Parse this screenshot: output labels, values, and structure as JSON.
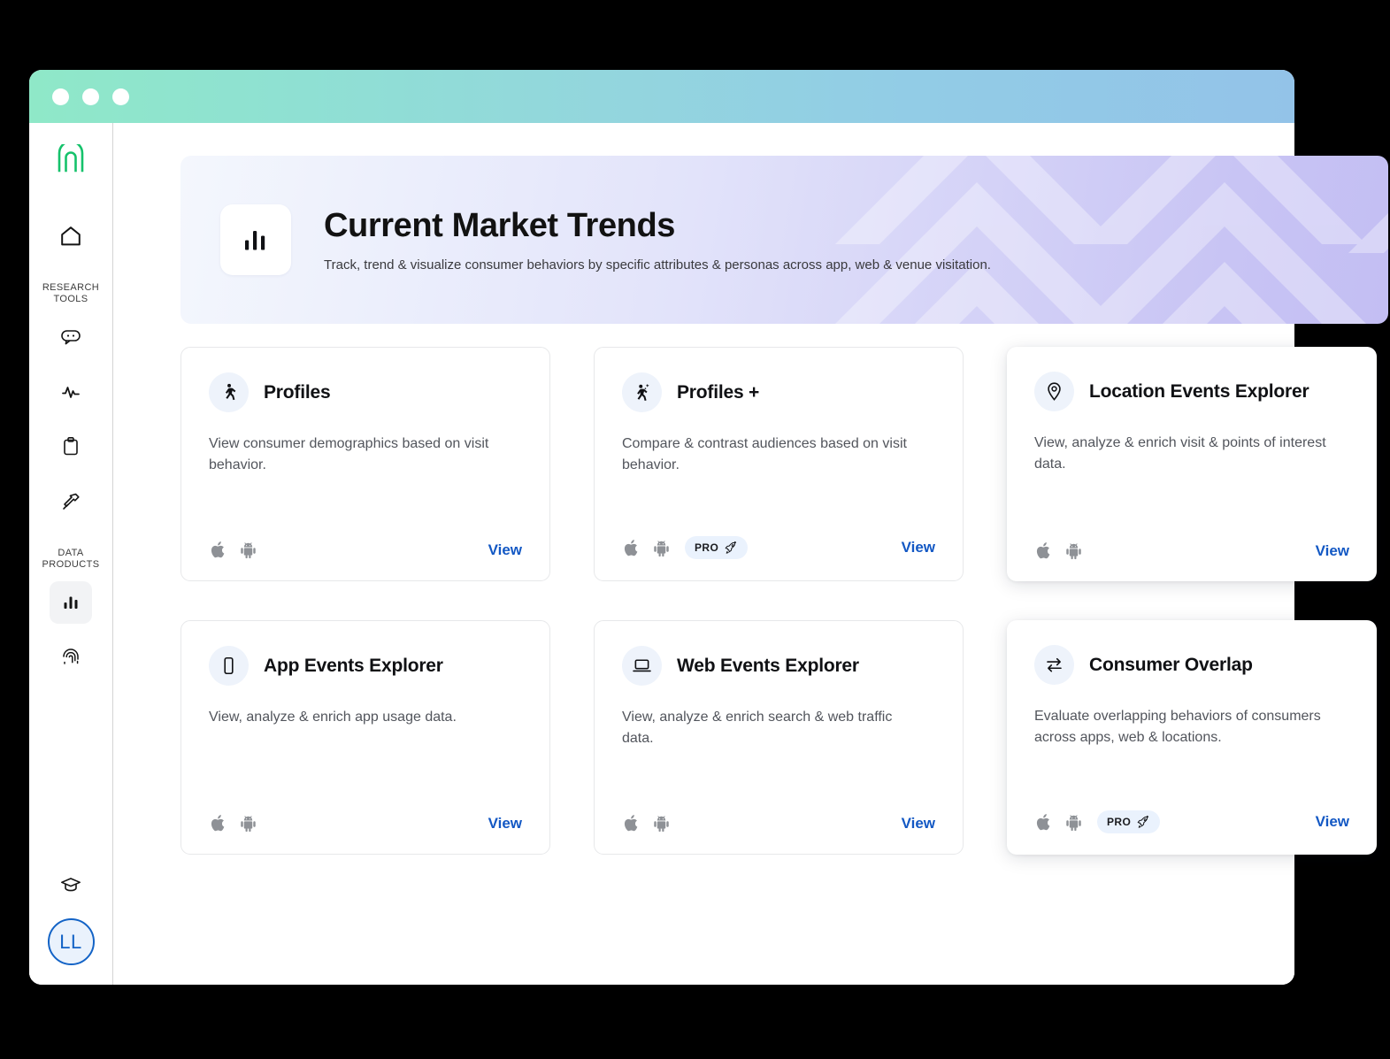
{
  "window": {
    "traffic_lights": [
      "close",
      "minimize",
      "maximize"
    ]
  },
  "sidebar": {
    "logo_name": "app-logo",
    "home_label": "Home",
    "sections": [
      {
        "label": "RESEARCH\nTOOLS",
        "label_line1": "RESEARCH",
        "label_line2": "TOOLS",
        "items": [
          {
            "icon": "chat-bubble-icon",
            "label": "Chat"
          },
          {
            "icon": "activity-pulse-icon",
            "label": "Activity"
          },
          {
            "icon": "clipboard-icon",
            "label": "Clipboard"
          },
          {
            "icon": "hammer-icon",
            "label": "Tools"
          }
        ]
      },
      {
        "label": "DATA\nPRODUCTS",
        "label_line1": "DATA",
        "label_line2": "PRODUCTS",
        "items": [
          {
            "icon": "bar-chart-icon",
            "label": "Data Products",
            "active": true
          },
          {
            "icon": "fingerprint-icon",
            "label": "Identity"
          }
        ]
      }
    ],
    "footer": {
      "help_icon": "graduation-cap-icon",
      "help_label": "Learning",
      "avatar_initials": "LL"
    }
  },
  "hero": {
    "icon": "bar-chart-icon",
    "title": "Current Market Trends",
    "subtitle": "Track, trend & visualize consumer behaviors by specific attributes & personas across app, web & venue visitation.",
    "accent_start": "#f4f7fd",
    "accent_end": "#c3bef3"
  },
  "cards": [
    {
      "id": "profiles",
      "icon": "walking-person-icon",
      "title": "Profiles",
      "description": "View consumer demographics based on visit behavior.",
      "platforms": [
        "apple-icon",
        "android-icon"
      ],
      "pro": false,
      "pro_label": "PRO",
      "action_label": "View",
      "floating": false
    },
    {
      "id": "profiles-plus",
      "icon": "walking-person-sparkle-icon",
      "title": "Profiles +",
      "description": "Compare & contrast audiences based on visit behavior.",
      "platforms": [
        "apple-icon",
        "android-icon"
      ],
      "pro": true,
      "pro_label": "PRO",
      "action_label": "View",
      "floating": false
    },
    {
      "id": "location-events-explorer",
      "icon": "map-pin-icon",
      "title": "Location Events Explorer",
      "description": "View, analyze & enrich visit & points of interest data.",
      "platforms": [
        "apple-icon",
        "android-icon"
      ],
      "pro": false,
      "pro_label": "PRO",
      "action_label": "View",
      "floating": true
    },
    {
      "id": "app-events-explorer",
      "icon": "mobile-phone-icon",
      "title": "App Events Explorer",
      "description": "View, analyze & enrich app usage data.",
      "platforms": [
        "apple-icon",
        "android-icon"
      ],
      "pro": false,
      "pro_label": "PRO",
      "action_label": "View",
      "floating": false
    },
    {
      "id": "web-events-explorer",
      "icon": "laptop-icon",
      "title": "Web Events Explorer",
      "description": "View, analyze & enrich search & web traffic data.",
      "platforms": [
        "apple-icon",
        "android-icon"
      ],
      "pro": false,
      "pro_label": "PRO",
      "action_label": "View",
      "floating": false
    },
    {
      "id": "consumer-overlap",
      "icon": "exchange-arrows-icon",
      "title": "Consumer Overlap",
      "description": "Evaluate overlapping behaviors of consumers across apps, web & locations.",
      "platforms": [
        "apple-icon",
        "android-icon"
      ],
      "pro": true,
      "pro_label": "PRO",
      "action_label": "View",
      "floating": true
    }
  ],
  "colors": {
    "link": "#1358c4",
    "pro_badge_bg": "#eaf2fd",
    "card_icon_bg": "#eef3fb",
    "avatar_border": "#1363c6",
    "logo_green": "#15c26b"
  }
}
